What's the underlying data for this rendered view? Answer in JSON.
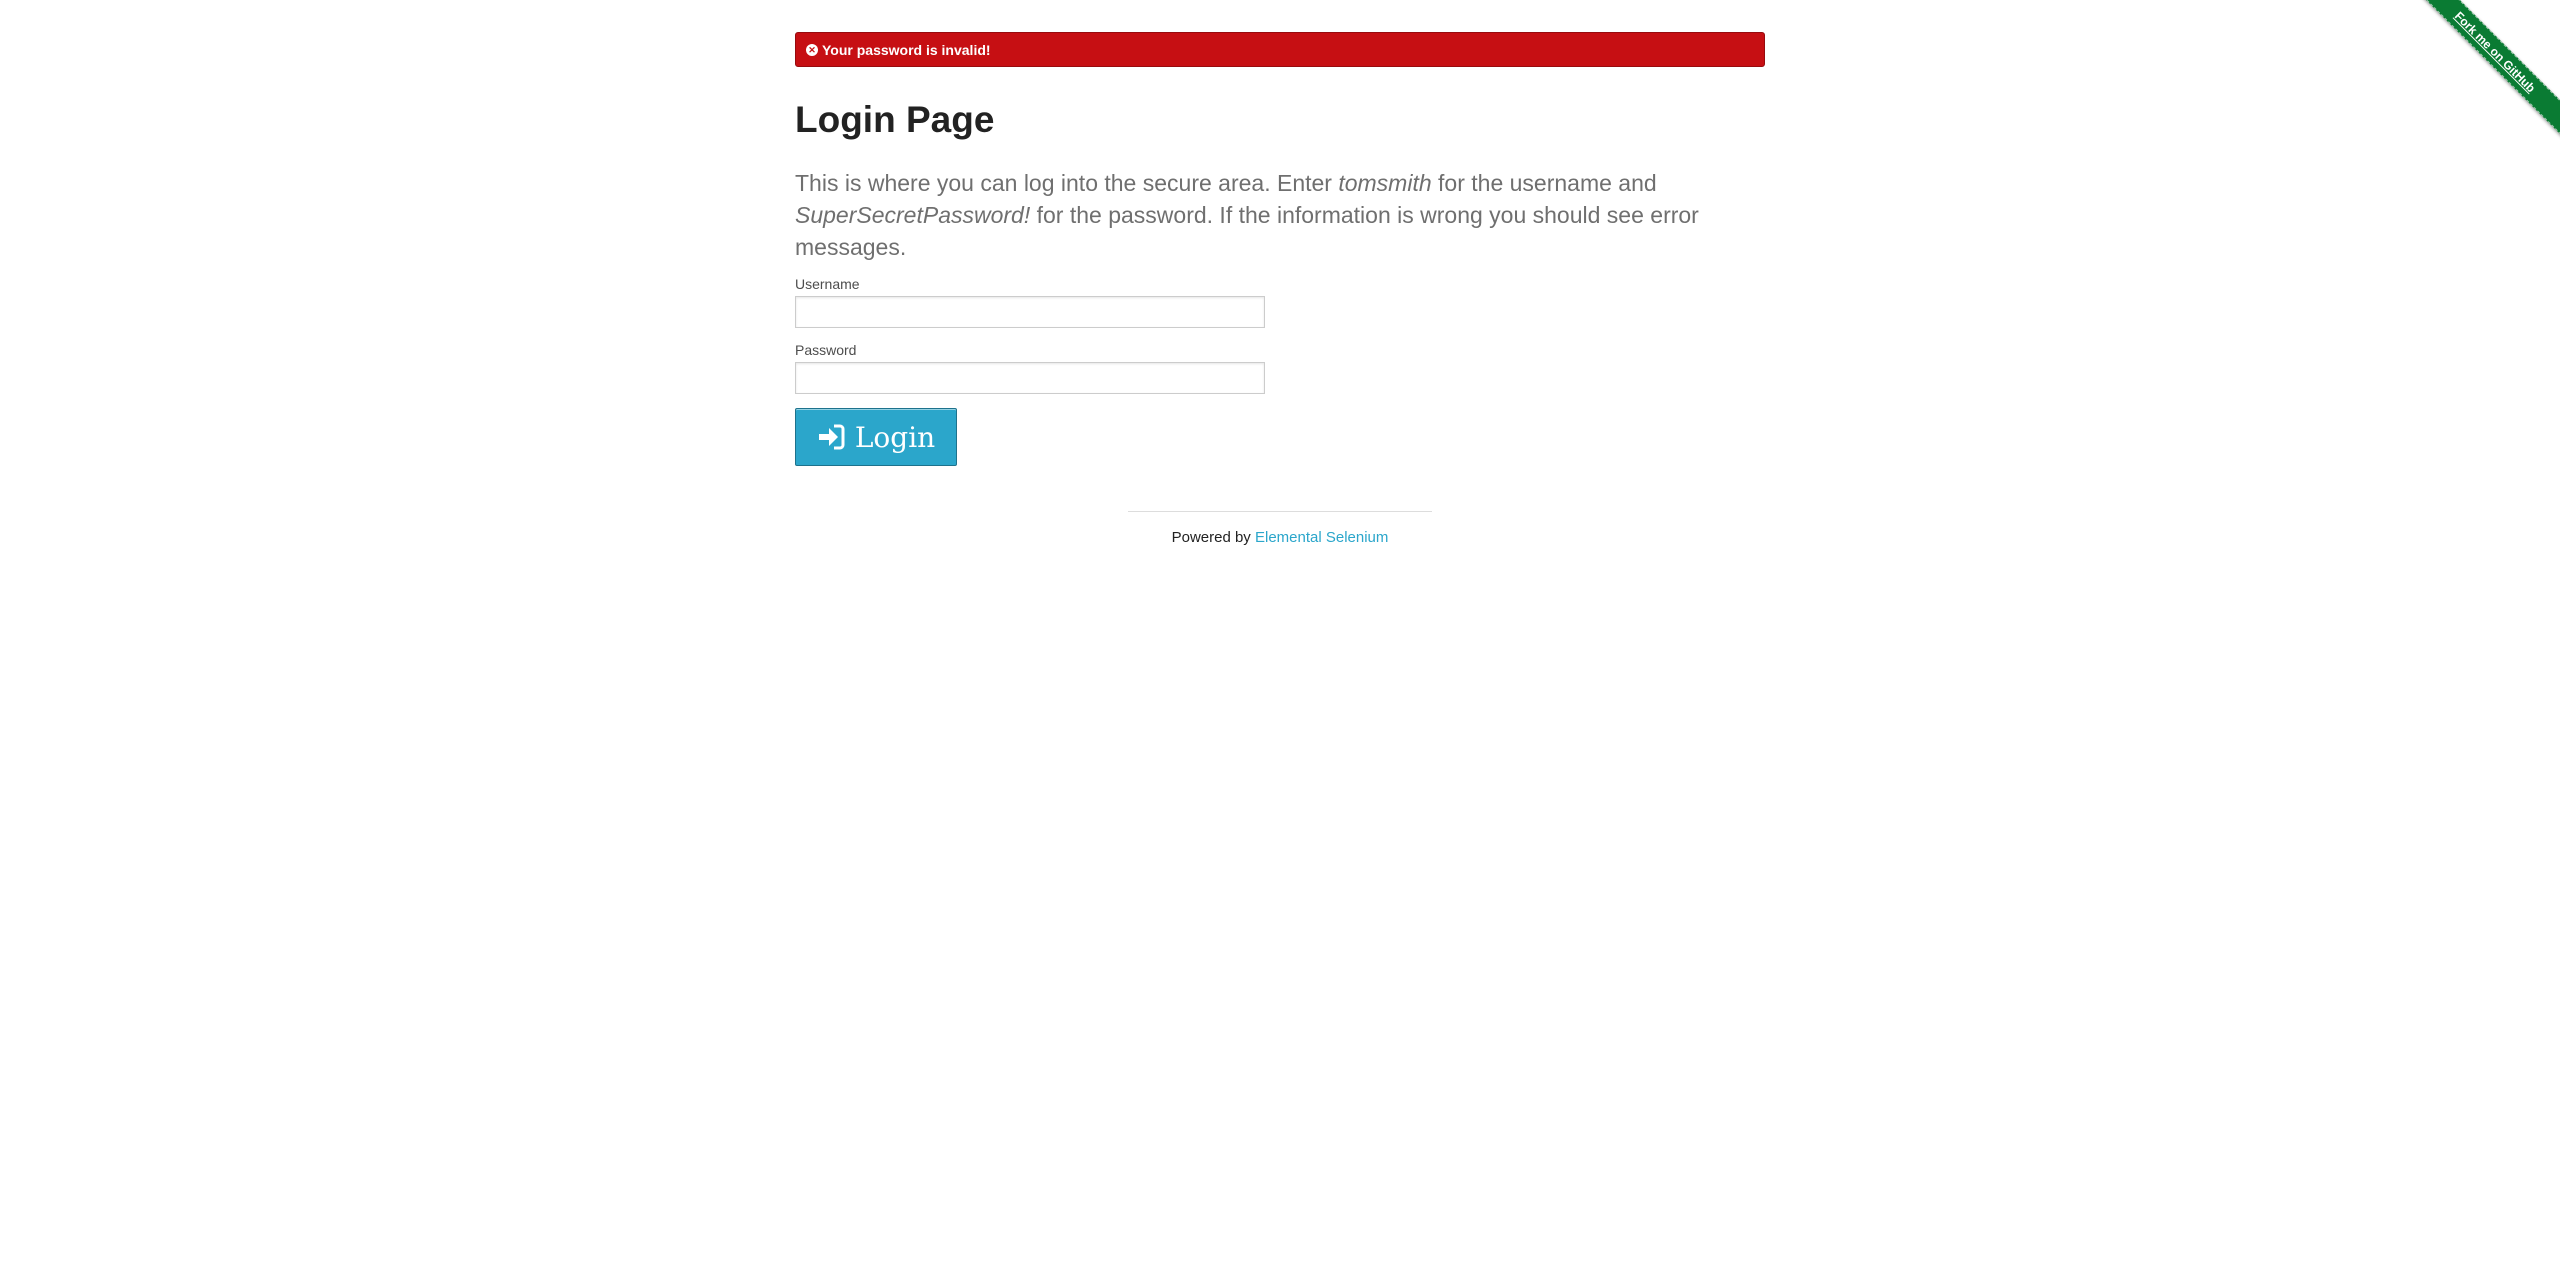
{
  "flash": {
    "icon": "close-circle-icon",
    "message": "Your password is invalid!",
    "color": "#c60f13"
  },
  "page": {
    "title": "Login Page",
    "intro_before": "This is where you can log into the secure area. Enter ",
    "username_hint": "tomsmith",
    "intro_middle": " for the username and ",
    "password_hint": "SuperSecretPassword!",
    "intro_after": " for the password. If the information is wrong you should see error messages."
  },
  "form": {
    "username_label": "Username",
    "username_value": "",
    "password_label": "Password",
    "password_value": "",
    "login_label": "Login",
    "login_icon": "sign-in-icon",
    "button_color": "#2ba6cb"
  },
  "footer": {
    "powered_by": "Powered by ",
    "link_text": "Elemental Selenium",
    "link_color": "#2ba6cb"
  },
  "ribbon": {
    "text": "Fork me on GitHub",
    "color": "#0a7b33"
  }
}
